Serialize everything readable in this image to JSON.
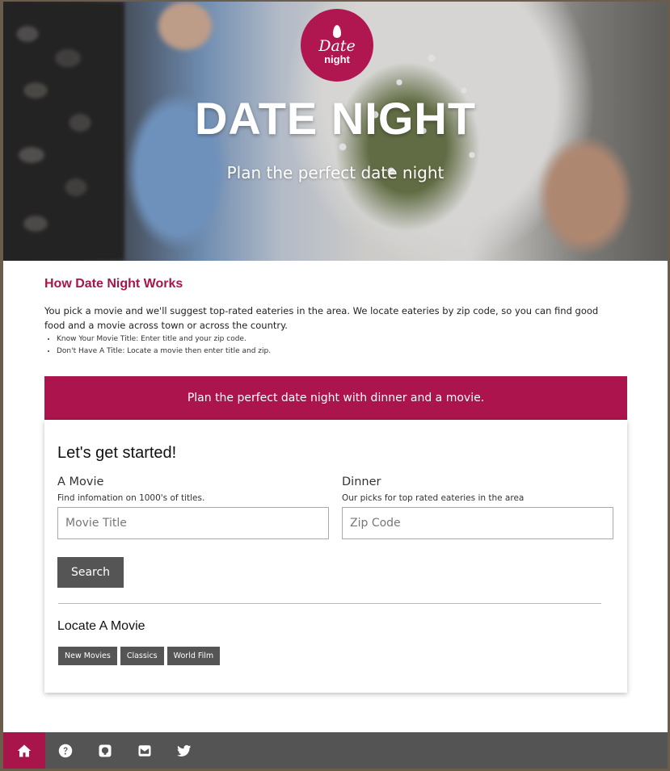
{
  "hero": {
    "logo_line1": "Date",
    "logo_line2": "night",
    "title": "DATE NIGHT",
    "subtitle": "Plan the perfect date night"
  },
  "how": {
    "title": "How Date Night Works",
    "text": "You pick a movie and we'll suggest top-rated eateries in the area. We locate eateries by zip code, so you can find good food and a movie across town or across the country.",
    "bullets": [
      "Know Your Movie Title: Enter title and your zip code.",
      "Don't Have A Title: Locate a movie then enter title and zip."
    ]
  },
  "banner": {
    "text": "Plan the perfect date night with dinner and a movie."
  },
  "form": {
    "title": "Let's get started!",
    "movie_label": "A Movie",
    "movie_help": "Find infomation on 1000's of titles.",
    "movie_placeholder": "Movie Title",
    "dinner_label": "Dinner",
    "dinner_help": "Our picks for top rated eateries in the area",
    "dinner_placeholder": "Zip Code",
    "search_label": "Search"
  },
  "locate": {
    "title": "Locate A Movie",
    "chips": [
      "New Movies",
      "Classics",
      "World Film"
    ]
  },
  "footer": {
    "icons": [
      "home-icon",
      "help-icon",
      "github-icon",
      "envelope-icon",
      "twitter-icon"
    ]
  },
  "colors": {
    "accent": "#ab144c",
    "button": "#555555",
    "footer": "#545454"
  }
}
